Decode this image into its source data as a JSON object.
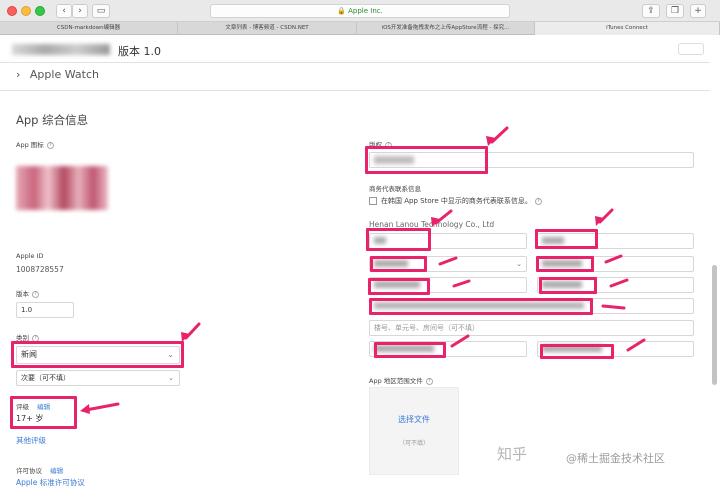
{
  "browser": {
    "url": "Apple Inc.",
    "tabs": [
      "CSDN-markdown编辑器",
      "文章列表 - 博客频道 - CSDN.NET",
      "iOS开发准备拖拽发布之上传AppStore流程 - 探究...",
      "iTunes Connect"
    ],
    "active_tab": 3
  },
  "header": {
    "version_title": "版本 1.0",
    "platform": "Apple Watch",
    "chevron": "›"
  },
  "left": {
    "section_title": "App 综合信息",
    "app_icon_label": "App 图标",
    "apple_id_label": "Apple ID",
    "apple_id_value": "1008728557",
    "version_label": "版本",
    "version_value": "1.0",
    "category_label": "类别",
    "primary_category": "新闻",
    "secondary_category": "次要（可不填）",
    "rating_label": "评级",
    "rating_edit": "编辑",
    "rating_value": "17+ 岁",
    "other_ratings": "其他评级",
    "license_label": "许可协议",
    "license_edit": "编辑",
    "license_link": "Apple 标准许可协议"
  },
  "right": {
    "copyright_label": "版权",
    "rep_label": "商务代表联系信息",
    "checkbox_label": "在韩国 App Store 中显示的商务代表联系信息。",
    "company": "Henan Lanou Technology Co., Ltd",
    "address_placeholder": "楼号、单元号、房间号（可不填）",
    "region_label": "App 地区范围文件",
    "choose_file": "选择文件",
    "optional": "（可不填）"
  },
  "watermark": {
    "brand": "知乎",
    "text": "@稀土掘金技术社区"
  },
  "colors": {
    "highlight": "#e8226b",
    "link": "#3a7bd5",
    "url_green": "#2e8b35"
  }
}
